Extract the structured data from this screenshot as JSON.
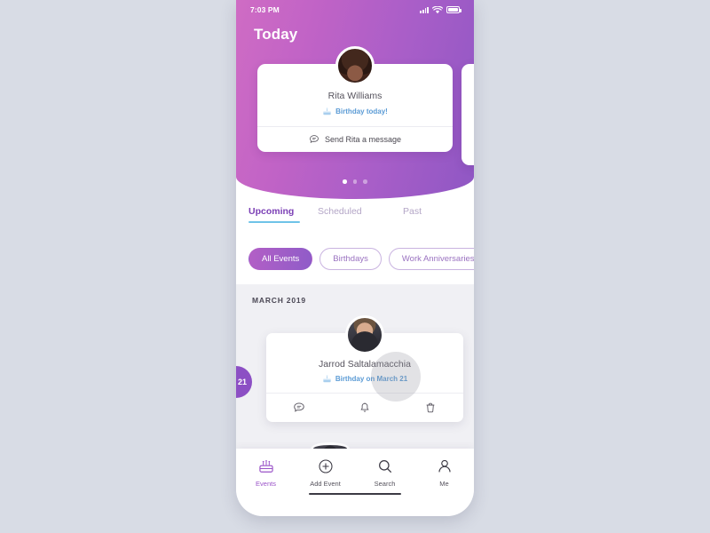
{
  "background_color": "#d8dce5",
  "status_bar": {
    "time": "7:03 PM",
    "signal_icon": "cellular-bars-icon",
    "wifi_icon": "wifi-icon",
    "battery_icon": "battery-full-icon"
  },
  "header": {
    "title": "Today",
    "gradient_from": "#cf6cc4",
    "gradient_to": "#8f57c4"
  },
  "hero_card": {
    "name": "Rita Williams",
    "event_label": "Birthday today!",
    "event_icon": "cake-icon",
    "event_color": "#5b9bd5",
    "action_label": "Send Rita a message",
    "action_icon": "message-icon",
    "avatar": "avatar-rita-williams"
  },
  "carousel": {
    "total_dots": 3,
    "active_index": 0
  },
  "tabs": [
    {
      "label": "Upcoming",
      "active": true
    },
    {
      "label": "Scheduled",
      "active": false
    },
    {
      "label": "Past",
      "active": false
    }
  ],
  "tab_accent_color": "#6fc3e8",
  "tab_active_color": "#7b3fb5",
  "chips": [
    {
      "label": "All Events",
      "active": true
    },
    {
      "label": "Birthdays",
      "active": false
    },
    {
      "label": "Work Anniversaries",
      "active": false
    }
  ],
  "list": {
    "month_label": "MARCH 2019",
    "date_badge": "21",
    "event": {
      "name": "Jarrod Saltalamacchia",
      "event_label": "Birthday on March 21",
      "event_icon": "cake-icon",
      "avatar": "avatar-jarrod-saltalamacchia",
      "actions": [
        {
          "icon": "message-icon",
          "name": "message-action"
        },
        {
          "icon": "bell-icon",
          "name": "reminder-action"
        },
        {
          "icon": "trash-icon",
          "name": "delete-action"
        }
      ]
    }
  },
  "bottom_nav": [
    {
      "label": "Events",
      "icon": "cake-icon",
      "active": true
    },
    {
      "label": "Add Event",
      "icon": "plus-circle-icon",
      "active": false
    },
    {
      "label": "Search",
      "icon": "search-icon",
      "active": false
    },
    {
      "label": "Me",
      "icon": "person-icon",
      "active": false
    }
  ],
  "accent_purple": "#8c4fc4"
}
